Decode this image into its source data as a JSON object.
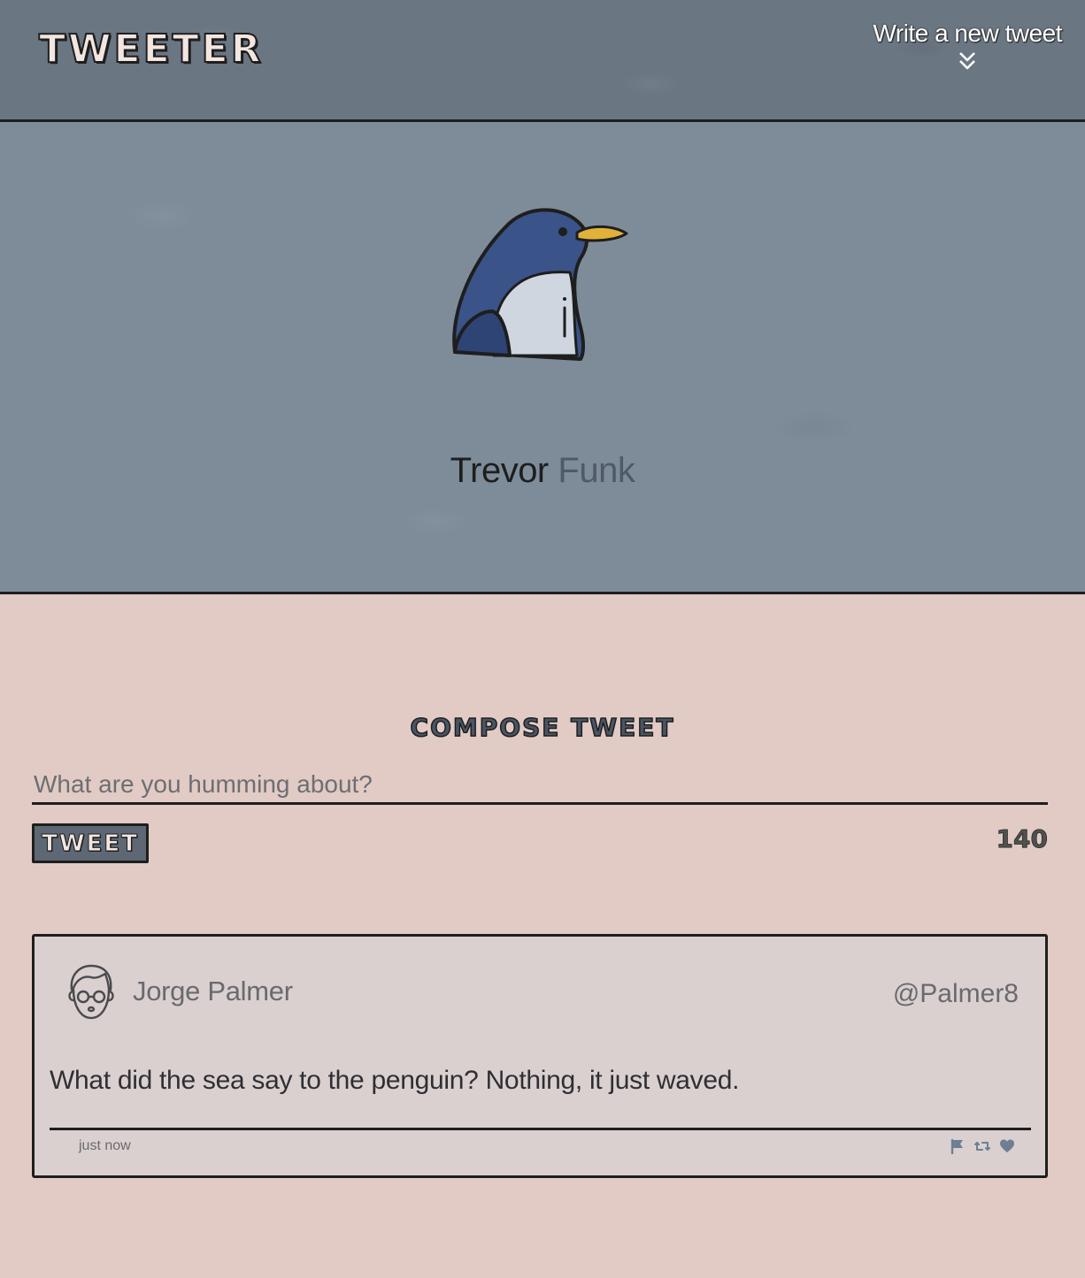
{
  "header": {
    "brand": "TWEETER",
    "compose_toggle_label": "Write a new tweet",
    "compose_toggle_icon": "double-chevron-down-icon"
  },
  "profile": {
    "avatar_icon": "penguin-icon",
    "first_name": "Trevor",
    "last_name": "Funk"
  },
  "compose": {
    "title": "COMPOSE TWEET",
    "placeholder": "What are you humming about?",
    "value": "",
    "submit_label": "TWEET",
    "char_counter": "140"
  },
  "tweets": [
    {
      "avatar_icon": "user-glasses-avatar-icon",
      "author_name": "Jorge Palmer",
      "handle": "@Palmer8",
      "content": "What did the sea say to the penguin? Nothing, it just waved.",
      "time": "just now",
      "actions": [
        "flag-icon",
        "retweet-icon",
        "heart-icon"
      ]
    }
  ],
  "colors": {
    "header_bg": "#6b7683",
    "profile_bg": "#7e8c9a",
    "page_bg": "#e1cbc4",
    "button_bg": "#5d6874",
    "border": "#1e1e1e",
    "action_icon": "#6e7f94"
  }
}
